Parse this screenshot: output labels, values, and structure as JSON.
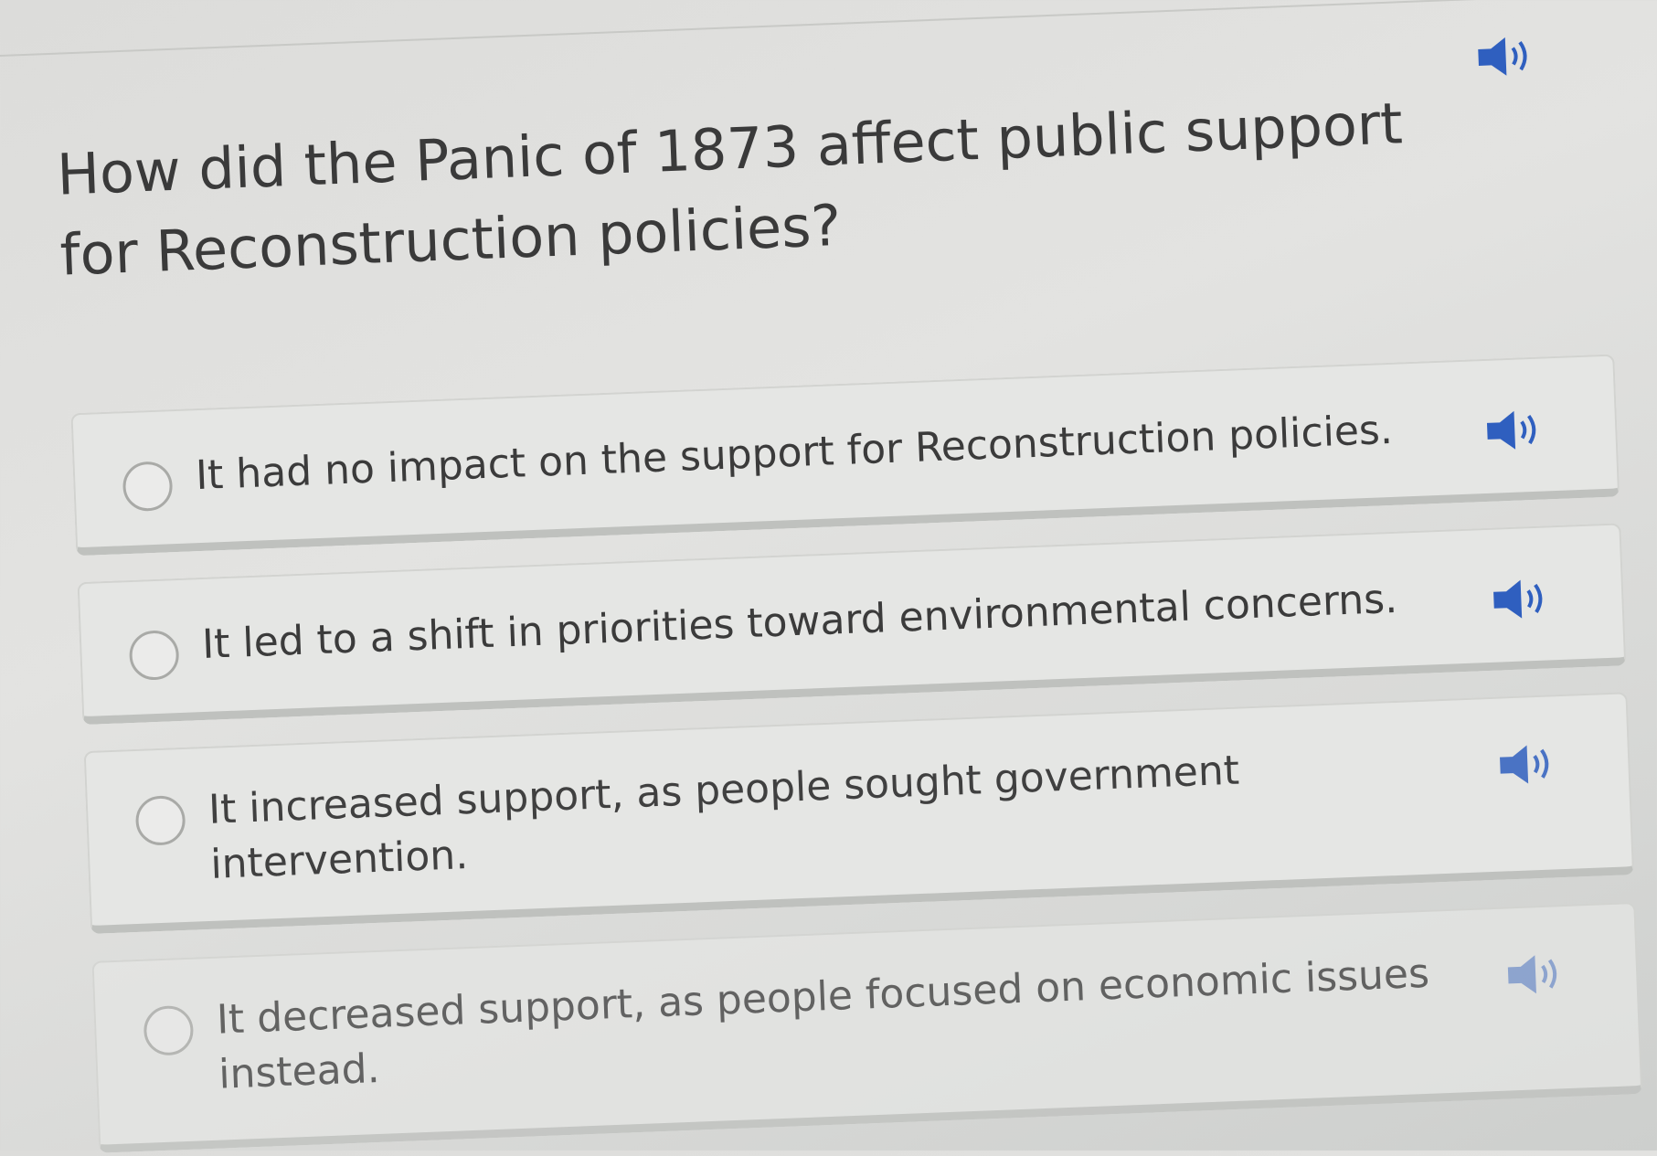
{
  "question": {
    "text": "How did the Panic of 1873 affect public support for Reconstruction policies?",
    "speaker_icon": "speaker-icon"
  },
  "options": [
    {
      "text": "It had no impact on the support for Reconstruction policies.",
      "selected": false
    },
    {
      "text": "It led to a shift in priorities toward environmental concerns.",
      "selected": false
    },
    {
      "text": "It increased support, as people sought government intervention.",
      "selected": false
    },
    {
      "text": "It decreased support, as people focused on economic issues instead.",
      "selected": false
    }
  ],
  "colors": {
    "speaker": "#2f5fbf",
    "text": "#3a3a3a",
    "card": "#e5e6e4"
  }
}
